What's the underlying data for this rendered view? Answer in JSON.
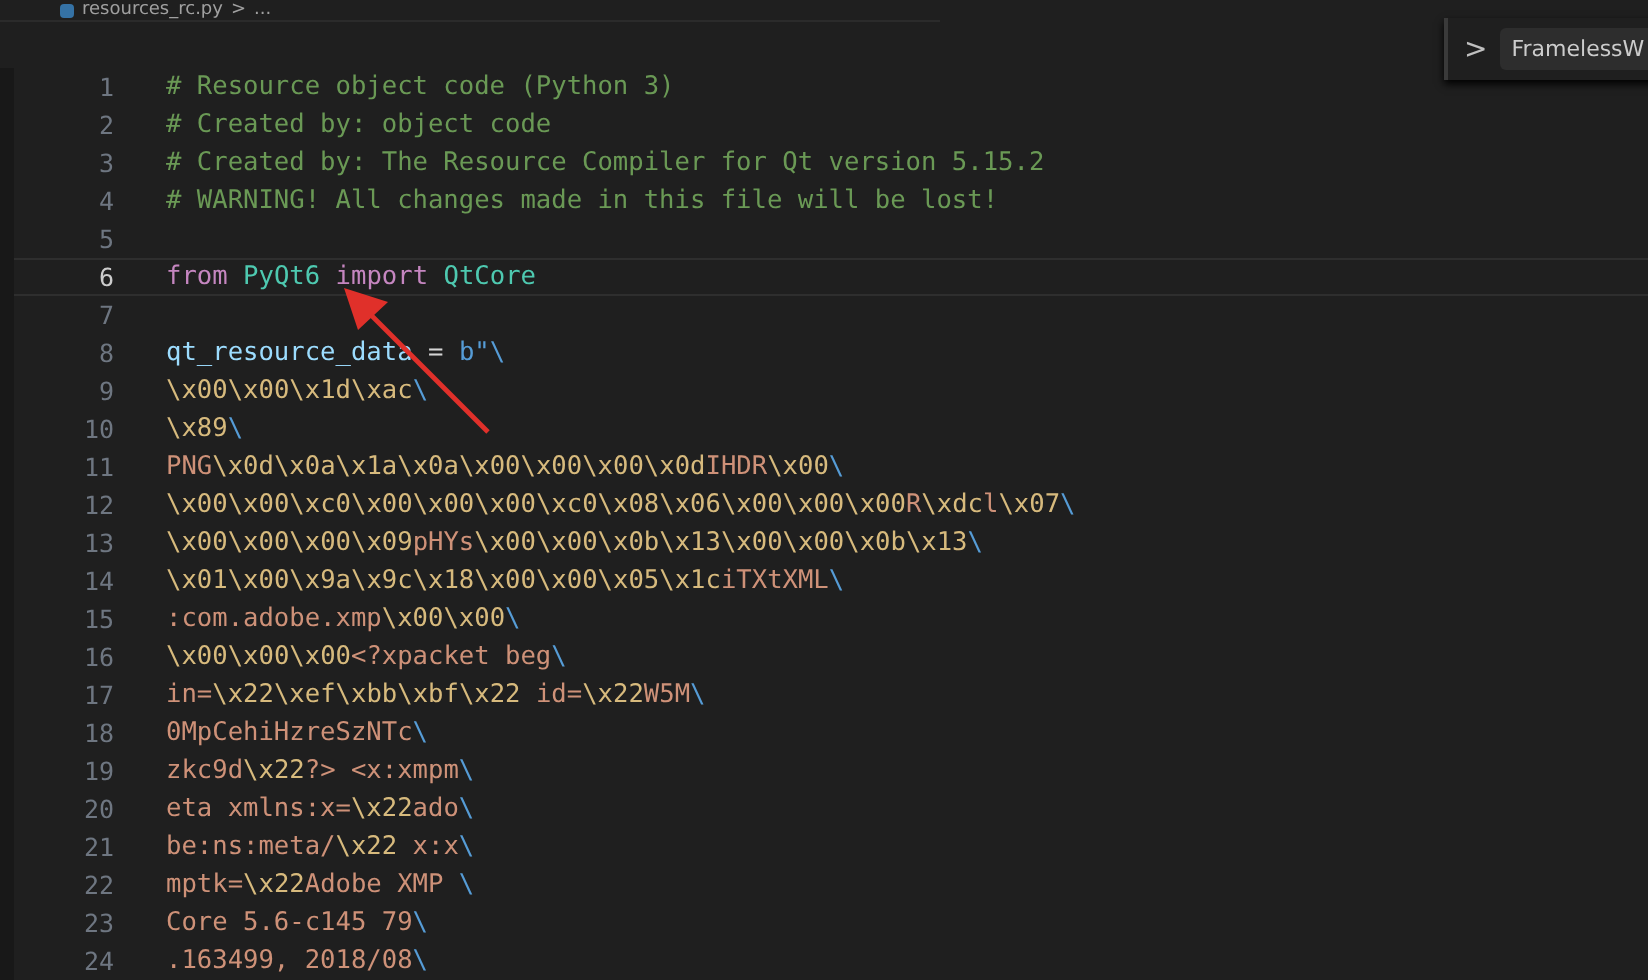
{
  "breadcrumb": {
    "file": "resources_rc.py",
    "separator": ">",
    "rest": "..."
  },
  "sticky_scroll": {
    "chevron": ">",
    "label": "FramelessW"
  },
  "lines": [
    {
      "number": "1",
      "current": false,
      "kind": "comment",
      "text": "# Resource object code (Python 3)"
    },
    {
      "number": "2",
      "current": false,
      "kind": "comment",
      "text": "# Created by: object code"
    },
    {
      "number": "3",
      "current": false,
      "kind": "comment",
      "text": "# Created by: The Resource Compiler for Qt version 5.15.2"
    },
    {
      "number": "4",
      "current": false,
      "kind": "comment",
      "text": "# WARNING! All changes made in this file will be lost!"
    },
    {
      "number": "5",
      "current": false,
      "kind": "blank"
    },
    {
      "number": "6",
      "current": true,
      "kind": "code",
      "tokens": [
        {
          "kind": "keyword",
          "text": "from"
        },
        {
          "kind": "module",
          "text": "PyQt6"
        },
        {
          "kind": "keyword",
          "text": "import"
        },
        {
          "kind": "module",
          "text": "QtCore"
        }
      ]
    },
    {
      "number": "7",
      "current": false,
      "kind": "blank"
    },
    {
      "number": "8",
      "current": false,
      "kind": "code",
      "tokens": [
        {
          "kind": "variable",
          "text": "qt_resource_data"
        },
        {
          "kind": "operator",
          "text": "="
        },
        {
          "kind": "prefix",
          "text": "b\"\\"
        }
      ]
    },
    {
      "number": "9",
      "current": false,
      "kind": "string",
      "text": "\\x00\\x00\\x1d\\xac\\"
    },
    {
      "number": "10",
      "current": false,
      "kind": "string",
      "text": "\\x89\\"
    },
    {
      "number": "11",
      "current": false,
      "kind": "string",
      "text": "PNG\\x0d\\x0a\\x1a\\x0a\\x00\\x00\\x00\\x0dIHDR\\x00\\"
    },
    {
      "number": "12",
      "current": false,
      "kind": "string",
      "text": "\\x00\\x00\\xc0\\x00\\x00\\x00\\xc0\\x08\\x06\\x00\\x00\\x00R\\xdcl\\x07\\"
    },
    {
      "number": "13",
      "current": false,
      "kind": "string",
      "text": "\\x00\\x00\\x00\\x09pHYs\\x00\\x00\\x0b\\x13\\x00\\x00\\x0b\\x13\\"
    },
    {
      "number": "14",
      "current": false,
      "kind": "string",
      "text": "\\x01\\x00\\x9a\\x9c\\x18\\x00\\x00\\x05\\x1ciTXtXML\\"
    },
    {
      "number": "15",
      "current": false,
      "kind": "string",
      "text": ":com.adobe.xmp\\x00\\x00\\"
    },
    {
      "number": "16",
      "current": false,
      "kind": "string",
      "text": "\\x00\\x00\\x00<?xpacket beg\\"
    },
    {
      "number": "17",
      "current": false,
      "kind": "string",
      "text": "in=\\x22\\xef\\xbb\\xbf\\x22 id=\\x22W5M\\"
    },
    {
      "number": "18",
      "current": false,
      "kind": "string",
      "text": "0MpCehiHzreSzNTc\\"
    },
    {
      "number": "19",
      "current": false,
      "kind": "string",
      "text": "zkc9d\\x22?> <x:xmpm\\"
    },
    {
      "number": "20",
      "current": false,
      "kind": "string",
      "text": "eta xmlns:x=\\x22ado\\"
    },
    {
      "number": "21",
      "current": false,
      "kind": "string",
      "text": "be:ns:meta/\\x22 x:x\\"
    },
    {
      "number": "22",
      "current": false,
      "kind": "string",
      "text": "mptk=\\x22Adobe XMP \\"
    },
    {
      "number": "23",
      "current": false,
      "kind": "string",
      "text": "Core 5.6-c145 79\\"
    },
    {
      "number": "24",
      "current": false,
      "kind": "string",
      "text": ".163499, 2018/08\\"
    }
  ]
}
